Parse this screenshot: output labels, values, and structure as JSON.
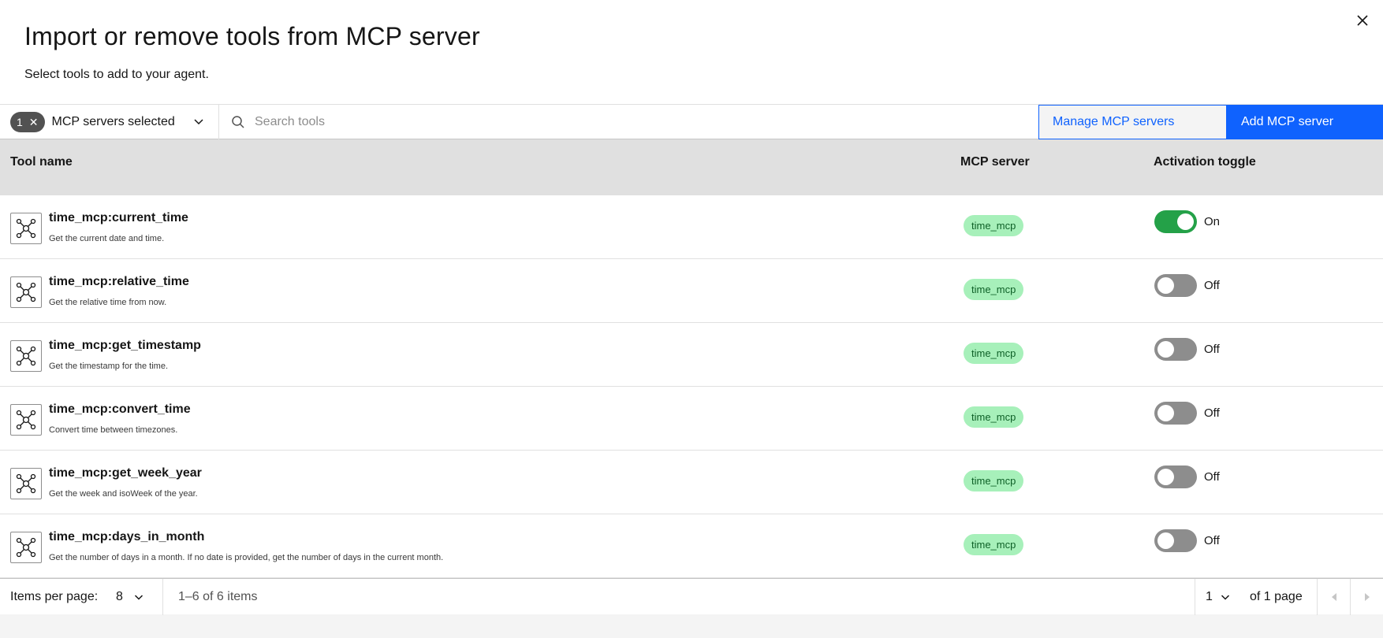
{
  "modal": {
    "title": "Import or remove tools from MCP server",
    "subtitle": "Select tools to add to your agent.",
    "close_icon": "close-icon"
  },
  "toolbar": {
    "filter_count": "1",
    "filter_label": "MCP servers selected",
    "search_placeholder": "Search tools",
    "manage_label": "Manage MCP servers",
    "add_label": "Add MCP server"
  },
  "table": {
    "headers": {
      "tool_name": "Tool name",
      "mcp_server": "MCP server",
      "activation": "Activation toggle"
    },
    "rows": [
      {
        "name": "time_mcp:current_time",
        "desc": "Get the current date and time.",
        "server": "time_mcp",
        "state": "On",
        "on": true
      },
      {
        "name": "time_mcp:relative_time",
        "desc": "Get the relative time from now.",
        "server": "time_mcp",
        "state": "Off",
        "on": false
      },
      {
        "name": "time_mcp:get_timestamp",
        "desc": "Get the timestamp for the time.",
        "server": "time_mcp",
        "state": "Off",
        "on": false
      },
      {
        "name": "time_mcp:convert_time",
        "desc": "Convert time between timezones.",
        "server": "time_mcp",
        "state": "Off",
        "on": false
      },
      {
        "name": "time_mcp:get_week_year",
        "desc": "Get the week and isoWeek of the year.",
        "server": "time_mcp",
        "state": "Off",
        "on": false
      },
      {
        "name": "time_mcp:days_in_month",
        "desc": "Get the number of days in a month. If no date is provided, get the number of days in the current month.",
        "server": "time_mcp",
        "state": "Off",
        "on": false
      }
    ]
  },
  "pagination": {
    "items_per_page_label": "Items per page:",
    "items_per_page_value": "8",
    "range": "1–6 of 6 items",
    "page_value": "1",
    "of_pages": "of 1 page"
  },
  "colors": {
    "primary": "#0f62fe",
    "toggle_on": "#24a148",
    "toggle_off": "#8d8d8d",
    "tag_bg": "#a7f0ba",
    "tag_text": "#0e6027"
  }
}
